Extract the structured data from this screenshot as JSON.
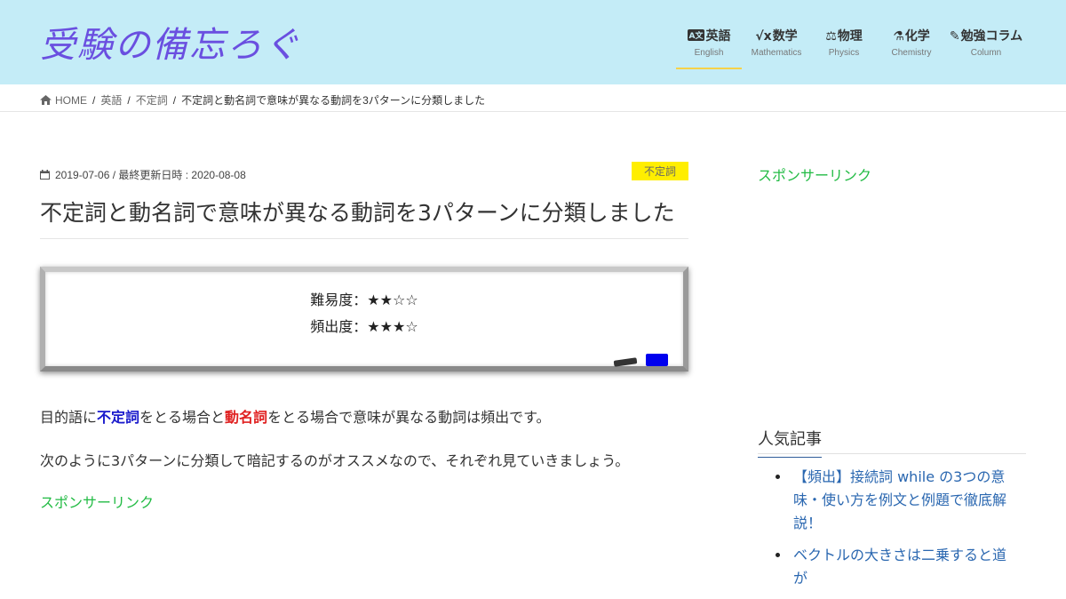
{
  "header": {
    "logo_text": "受験の備忘ろぐ",
    "nav": [
      {
        "icon": "A文",
        "label": "英語",
        "sub": "English"
      },
      {
        "icon": "√x",
        "label": "数学",
        "sub": "Mathematics"
      },
      {
        "icon": "⚖",
        "label": "物理",
        "sub": "Physics"
      },
      {
        "icon": "⚗",
        "label": "化学",
        "sub": "Chemistry"
      },
      {
        "icon": "✎",
        "label": "勉強コラム",
        "sub": "Column"
      }
    ]
  },
  "breadcrumb": {
    "home": "HOME",
    "sep": "/",
    "level1": "英語",
    "level2": "不定詞",
    "current": "不定詞と動名詞で意味が異なる動詞を3パターンに分類しました"
  },
  "article": {
    "date": "2019-07-06",
    "updated": " / 最終更新日時 : 2020-08-08",
    "category": "不定詞",
    "title": "不定詞と動名詞で意味が異なる動詞を3パターンに分類しました",
    "board": {
      "difficulty": "難易度：★★☆☆",
      "frequency": "頻出度：★★★☆"
    },
    "p1": {
      "a": "目的語に",
      "b": "不定詞",
      "c": "をとる場合と",
      "d": "動名詞",
      "e": "をとる場合で意味が異なる動詞は頻出です。"
    },
    "p2": "次のように3パターンに分類して暗記するのがオススメなので、それぞれ見ていきましょう。",
    "sponsor": "スポンサーリンク"
  },
  "sidebar": {
    "sponsor": "スポンサーリンク",
    "popular_title": "人気記事",
    "popular": [
      "【頻出】接続詞 while の3つの意味・使い方を例文と例題で徹底解説！",
      "ベクトルの大きさは二乗すると道が"
    ]
  },
  "colors": {
    "header_bg": "#c4ecf7",
    "logo": "#6a4fe0",
    "badge": "#ffee00",
    "link": "#2a67b0",
    "sponsor": "#22bb44"
  }
}
